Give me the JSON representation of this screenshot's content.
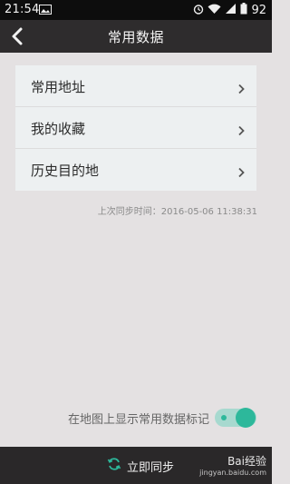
{
  "status_bar": {
    "time": "21:54",
    "battery": "92",
    "icons": [
      "image-icon",
      "alarm-icon",
      "wifi-icon",
      "signal-icon",
      "battery-icon"
    ]
  },
  "nav": {
    "title": "常用数据",
    "back_icon": "chevron-left-icon"
  },
  "list": {
    "items": [
      {
        "label": "常用地址",
        "icon": "chevron-right-icon"
      },
      {
        "label": "我的收藏",
        "icon": "chevron-right-icon"
      },
      {
        "label": "历史目的地",
        "icon": "chevron-right-icon"
      }
    ]
  },
  "sync": {
    "last_sync": "上次同步时间：2016-05-06 11:38:31"
  },
  "toggle": {
    "label": "在地图上显示常用数据标记",
    "on": true,
    "accent": "#2db89b"
  },
  "bottom": {
    "sync_now": "立即同步",
    "sync_icon": "refresh-icon"
  },
  "watermark": {
    "brand": "Bai经验",
    "url": "jingyan.baidu.com"
  }
}
